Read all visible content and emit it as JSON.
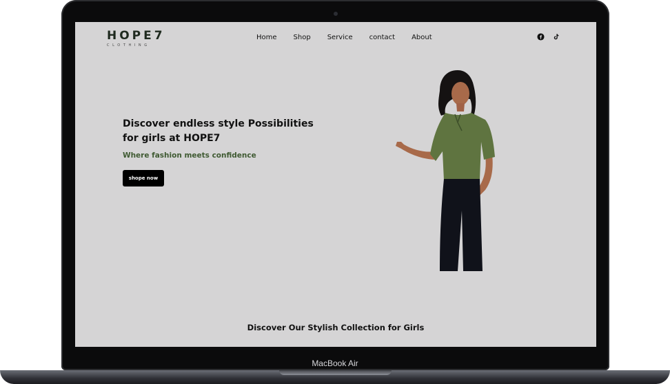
{
  "device": {
    "label": "MacBook Air"
  },
  "site": {
    "logo": {
      "main": "HOPE7",
      "sub": "CLOTHING"
    },
    "nav": [
      "Home",
      "Shop",
      "Service",
      "contact",
      "About"
    ],
    "socials": [
      "facebook-icon",
      "tiktok-icon"
    ]
  },
  "hero": {
    "title": "Discover endless style Possibilities for girls at HOPE7",
    "subtitle": "Where fashion meets confidence",
    "button": "shope now"
  },
  "section": {
    "title": "Discover Our Stylish Collection for Girls"
  },
  "colors": {
    "background": "#d5d4d5",
    "accent": "#3f5a32",
    "button": "#000000",
    "shirt": "#5f7440"
  }
}
